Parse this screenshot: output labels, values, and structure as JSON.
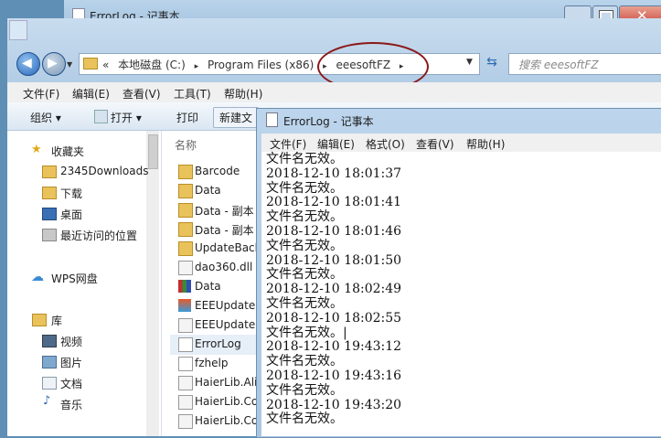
{
  "back_window": {
    "title": "ErrorLog - 记事本"
  },
  "explorer": {
    "address": {
      "nav_marker": "«",
      "crumbs": [
        "本地磁盘 (C:)",
        "Program Files (x86)",
        "eeesoftFZ"
      ],
      "separator": "▸"
    },
    "search_placeholder": "搜索 eeesoftFZ",
    "menu": [
      "文件(F)",
      "编辑(E)",
      "查看(V)",
      "工具(T)",
      "帮助(H)"
    ],
    "toolbar": {
      "organize": "组织 ▾",
      "open": "打开 ▾",
      "print": "打印",
      "new_folder": "新建文"
    },
    "nav": {
      "favorites_header": "收藏夹",
      "favorites": [
        "2345Downloads",
        "下载",
        "桌面",
        "最近访问的位置"
      ],
      "wps": "WPS网盘",
      "library_header": "库",
      "libraries": [
        "视频",
        "图片",
        "文档",
        "音乐"
      ]
    },
    "column_name": "名称",
    "files": [
      "Barcode",
      "Data",
      "Data - 副本",
      "Data - 副本",
      "UpdateBack",
      "dao360.dll",
      "Data",
      "EEEUpdate",
      "EEEUpdate.",
      "ErrorLog",
      "fzhelp",
      "HaierLib.Ali",
      "HaierLib.Co",
      "HaierLib.Co"
    ]
  },
  "notepad": {
    "title": "ErrorLog - 记事本",
    "menu": [
      "文件(F)",
      "编辑(E)",
      "格式(O)",
      "查看(V)",
      "帮助(H)"
    ],
    "lines": [
      "文件名无效。",
      "2018-12-10 18:01:37",
      "文件名无效。",
      "2018-12-10 18:01:41",
      "文件名无效。",
      "2018-12-10 18:01:46",
      "文件名无效。",
      "2018-12-10 18:01:50",
      "文件名无效。",
      "2018-12-10 18:02:49",
      "文件名无效。",
      "2018-12-10 18:02:55",
      "文件名无效。|",
      "2018-12-10 19:43:12",
      "文件名无效。",
      "2018-12-10 19:43:16",
      "文件名无效。",
      "2018-12-10 19:43:20",
      "文件名无效。"
    ]
  },
  "colors": {
    "annotation_circle": "#8b1818",
    "close_button": "#c9423a"
  }
}
